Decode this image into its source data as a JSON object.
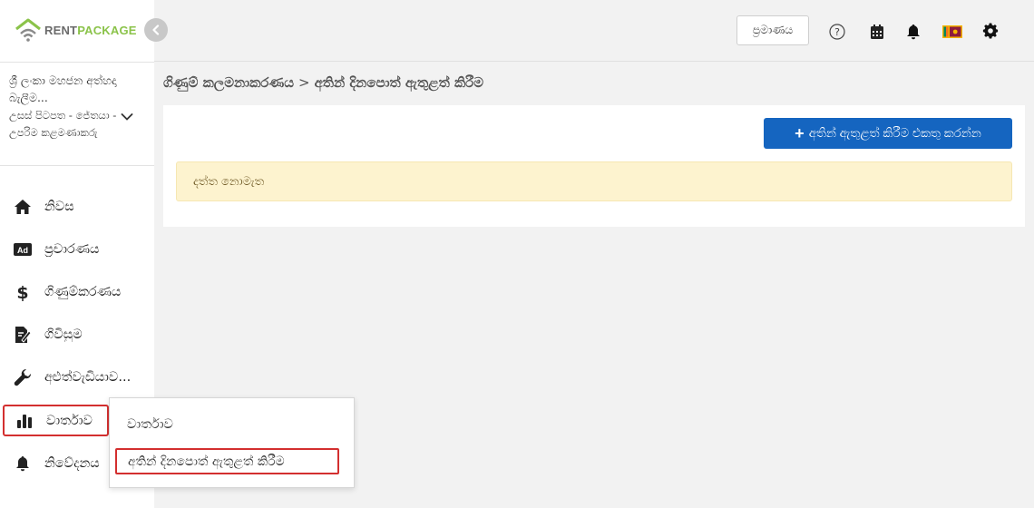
{
  "brand": {
    "name_part1": "RENT",
    "name_part2": "PACKAGE",
    "color_gray": "#6b6b6b",
    "color_green": "#8bc34a"
  },
  "account": {
    "name": "ශ්‍රී ලංකා මහජන අත්හදා බැලීම...",
    "role": "උසස් පිටපත - ජේතයා - උපරිම කළමණාකරු"
  },
  "sidebar": {
    "items": [
      {
        "label": "නිවස",
        "icon": "home-icon"
      },
      {
        "label": "ප්‍රචාරණය",
        "icon": "ad-icon"
      },
      {
        "label": "ගිණුම්කරණය",
        "icon": "dollar-icon"
      },
      {
        "label": "ගිවිසුම",
        "icon": "contract-icon"
      },
      {
        "label": "අළුත්වැඩියාව...",
        "icon": "wrench-icon"
      },
      {
        "label": "වාර්තාව",
        "icon": "bar-chart-icon"
      },
      {
        "label": "නිවේදනය",
        "icon": "bell-icon"
      }
    ]
  },
  "topbar": {
    "login_label": "ප්‍රමාණය"
  },
  "breadcrumb": {
    "parent": "ගිණුම් කලමනාකරණය",
    "separator": ">",
    "current": "අතින් දිනපොත් ඇතුළත් කිරීම"
  },
  "main": {
    "add_button_label": "අතින් ඇතුළත් කිරීම එකතු කරන්න",
    "empty_message": "දත්ත නොමැත"
  },
  "submenu": {
    "items": [
      {
        "label": "වාර්තාව"
      },
      {
        "label": "අතින් දිනපොත් ඇතුළත් කිරීම"
      }
    ]
  },
  "colors": {
    "primary": "#1565c0",
    "highlight": "#d32f2f",
    "alert_bg": "#fdf3cf"
  }
}
